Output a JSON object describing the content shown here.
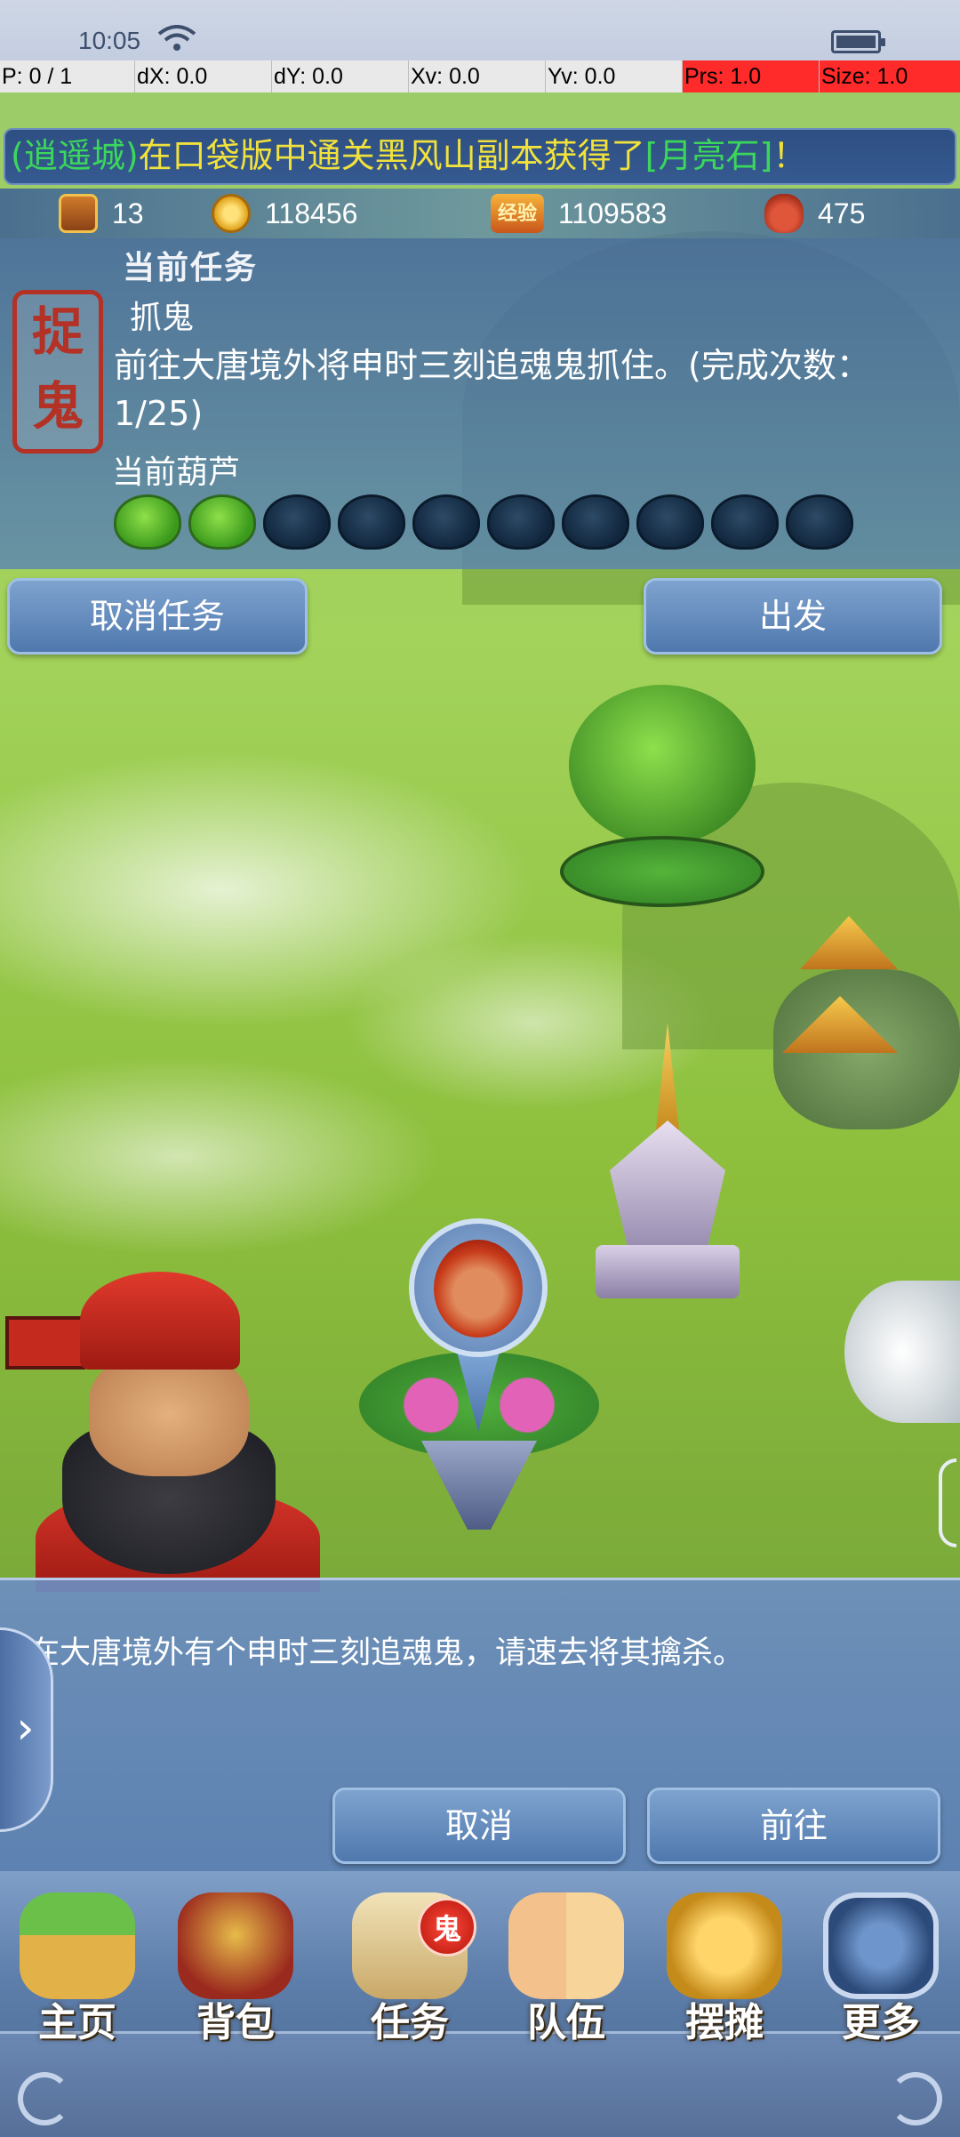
{
  "status_bar": {
    "time": "10:05"
  },
  "debug_bar": {
    "pointer": "P: 0 / 1",
    "dx": "dX: 0.0",
    "dy": "dY: 0.0",
    "xv": "Xv: 0.0",
    "yv": "Yv: 0.0",
    "prs": "Prs: 1.0",
    "size": "Size: 1.0"
  },
  "broadcast": {
    "player": "(逍遥城)",
    "message": "在口袋版中通关黑风山副本获得了",
    "item": "[月亮石]",
    "suffix": "！"
  },
  "currency": {
    "chest": "13",
    "coins": "118456",
    "exp_icon": "经验",
    "exp": "1109583",
    "pot": "475"
  },
  "task": {
    "seal_1": "捉",
    "seal_2": "鬼",
    "heading": "当前任务",
    "name": "抓鬼",
    "description": "前往大唐境外将申时三刻追魂鬼抓住。(完成次数：1/25)",
    "gourd_label": "当前葫芦",
    "gourd_filled": 2,
    "gourd_total": 10,
    "cancel_button": "取消任务",
    "go_button": "出发"
  },
  "dialog": {
    "text": "在大唐境外有个申时三刻追魂鬼，请速去将其擒杀。",
    "expand_arrow": "›",
    "cancel": "取消",
    "goto": "前往"
  },
  "nav": {
    "home": "主页",
    "bag": "背包",
    "task": "任务",
    "task_badge": "鬼",
    "team": "队伍",
    "stall": "摆摊",
    "more": "更多"
  },
  "colors": {
    "broadcast_player": "#3bd75b",
    "broadcast_item": "#f1e13c",
    "seal_red": "#b33125",
    "debug_red": "#ff2a2a"
  },
  "icons": [
    "wifi-icon",
    "battery-icon",
    "chest-icon",
    "coin-icon",
    "exp-icon",
    "pot-icon",
    "leaf-icon",
    "home-icon",
    "bag-icon",
    "task-icon",
    "team-icon",
    "stall-icon",
    "more-icon"
  ]
}
